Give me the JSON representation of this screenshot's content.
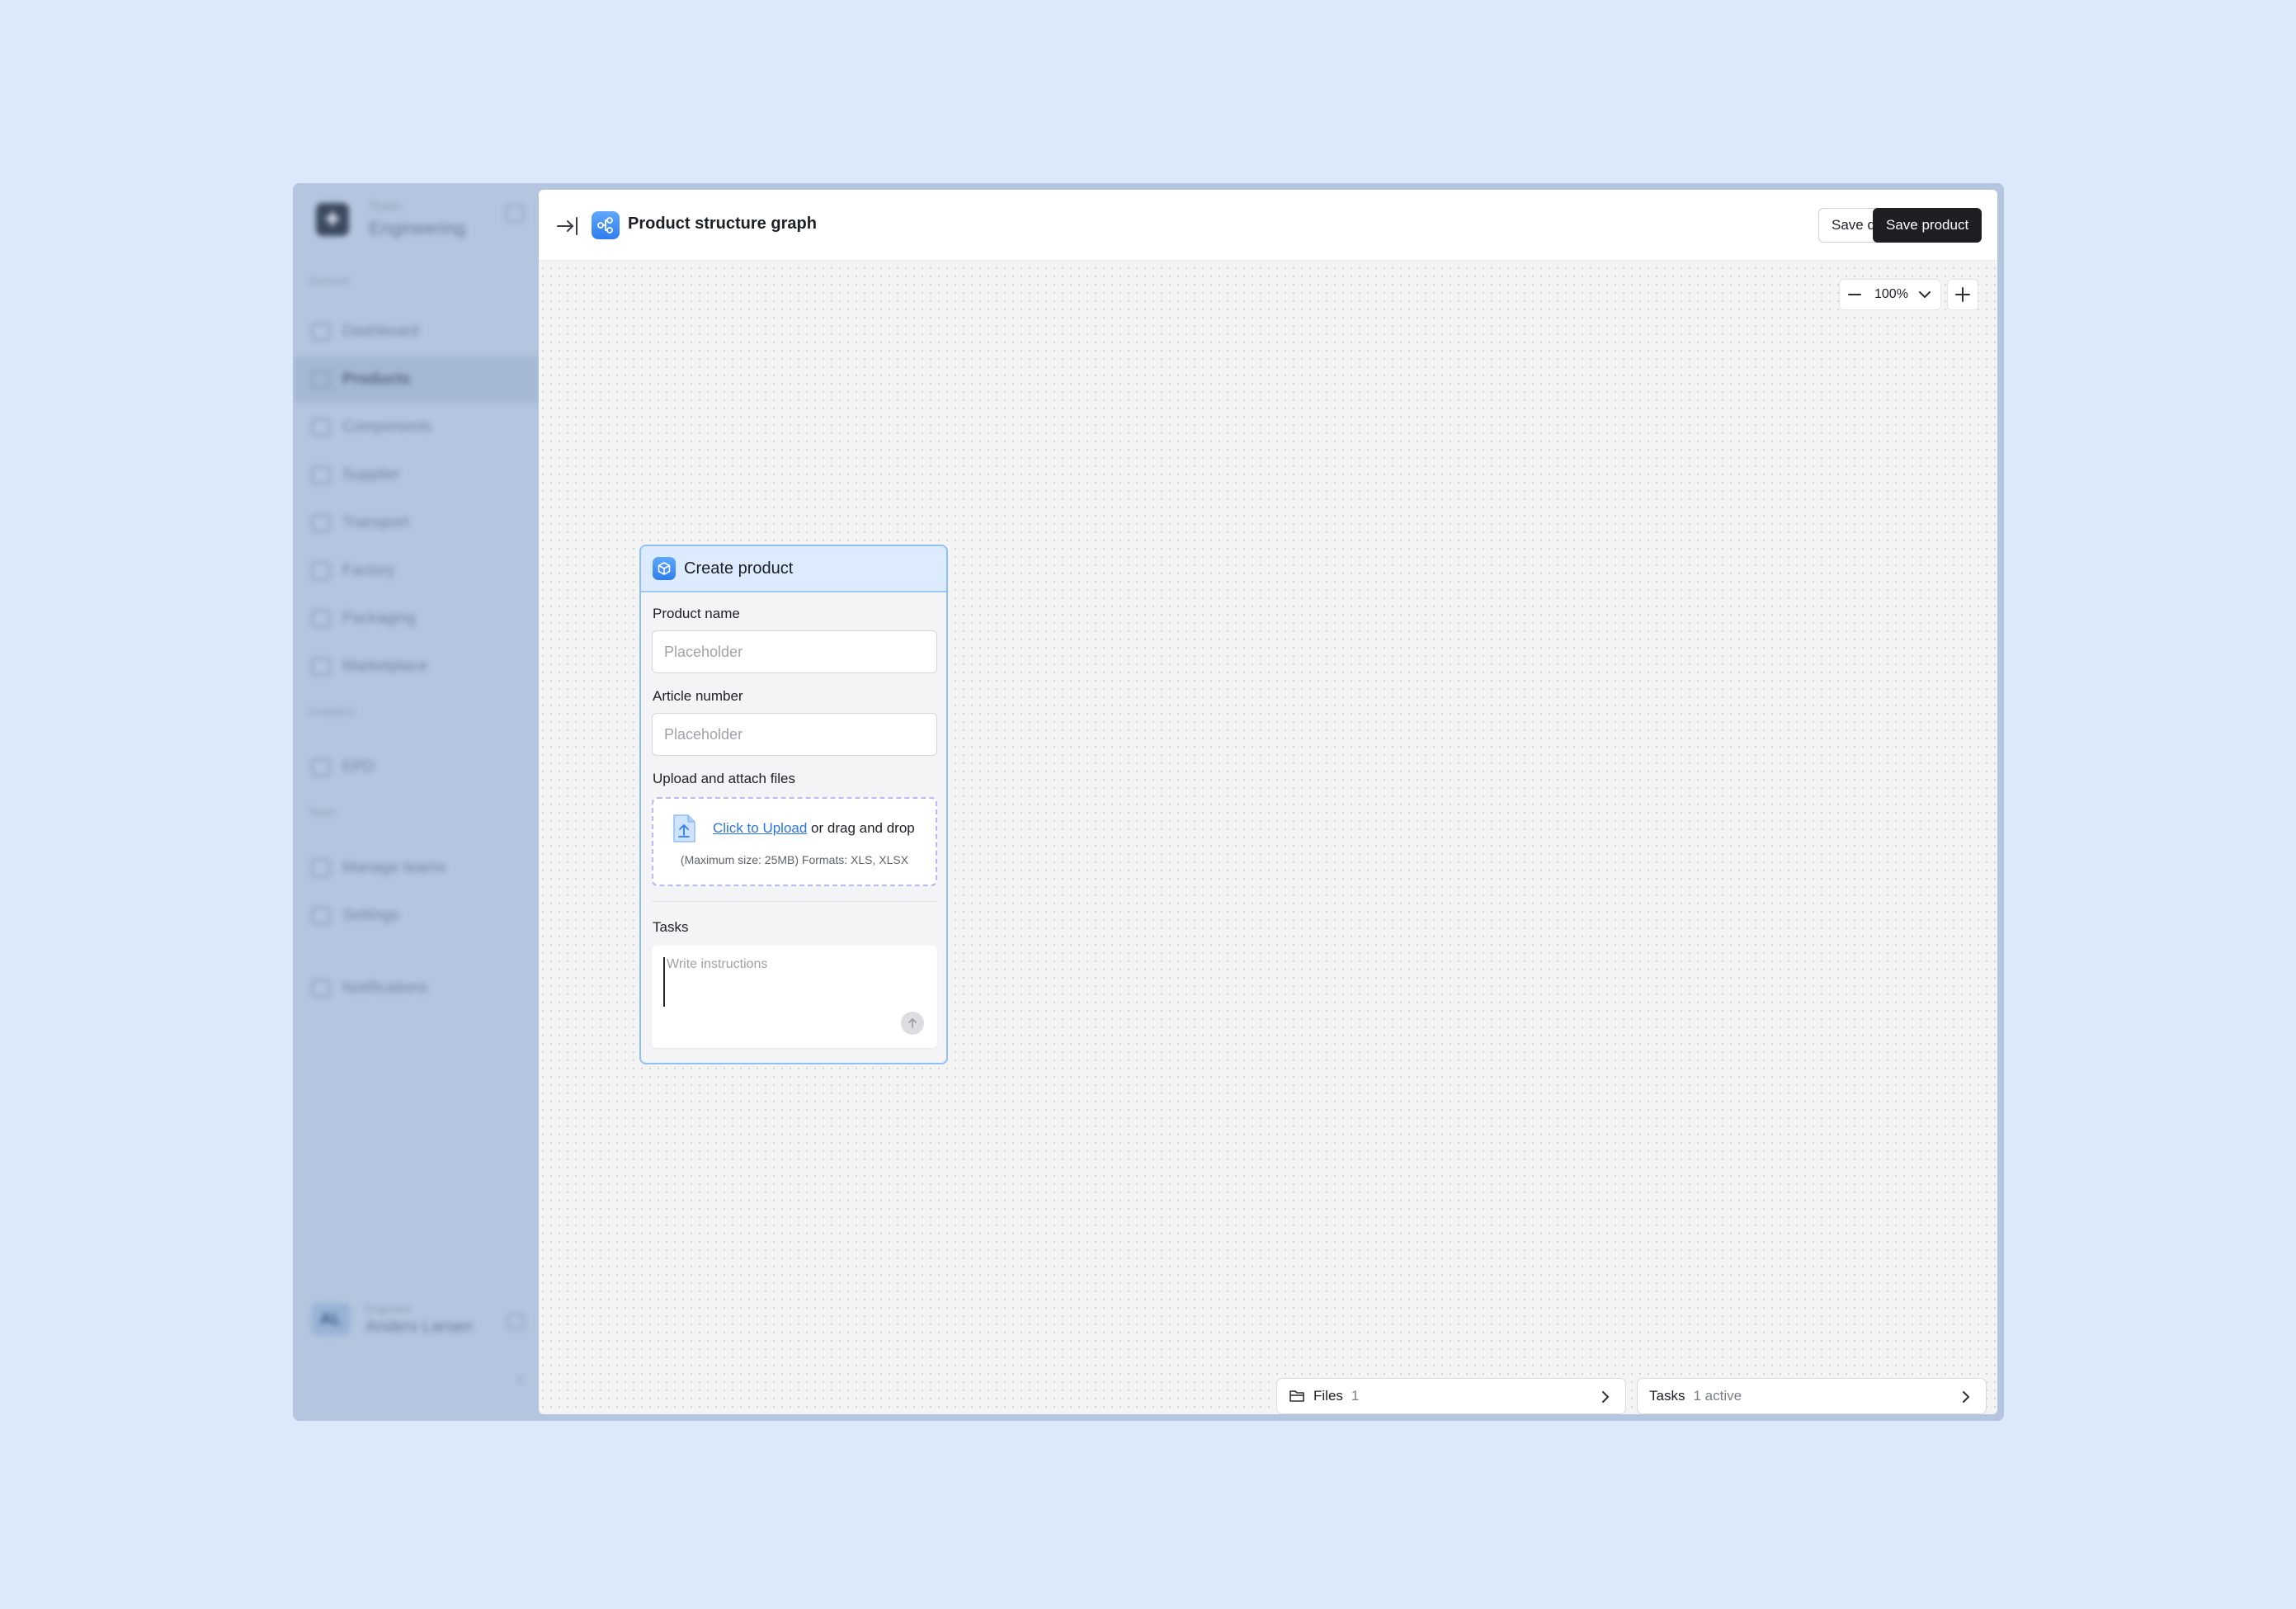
{
  "sidebar": {
    "workspace_small": "Team",
    "workspace_name": "Engineering",
    "section_general": "General",
    "section_analytics": "Analytics",
    "section_team": "Team",
    "items": [
      {
        "label": "Dashboard"
      },
      {
        "label": "Products"
      },
      {
        "label": "Components"
      },
      {
        "label": "Supplier"
      },
      {
        "label": "Transport"
      },
      {
        "label": "Factory"
      },
      {
        "label": "Packaging"
      },
      {
        "label": "Marketplace"
      },
      {
        "label": "EPD"
      },
      {
        "label": "Manage teams"
      },
      {
        "label": "Settings"
      },
      {
        "label": "Notifications"
      }
    ],
    "user_initials": "AL",
    "user_small": "Engineer",
    "user_name": "Anders Larsen"
  },
  "header": {
    "title": "Product structure graph",
    "save_draft_label": "Save draft",
    "save_product_label": "Save product"
  },
  "zoom": {
    "value": "100%"
  },
  "node": {
    "title": "Create product",
    "product_name_label": "Product name",
    "product_name_placeholder": "Placeholder",
    "article_number_label": "Article number",
    "article_number_placeholder": "Placeholder",
    "upload_label": "Upload and attach files",
    "upload_link": "Click to Upload",
    "upload_text": " or drag and drop",
    "upload_hint": "(Maximum size: 25MB) Formats: XLS, XLSX",
    "tasks_label": "Tasks",
    "tasks_placeholder": "Write instructions"
  },
  "bottom": {
    "files_label": "Files",
    "files_count": "1",
    "tasks_label": "Tasks",
    "tasks_count": "1 active"
  },
  "colors": {
    "background": "#dce9fb",
    "accent": "#2f7df0",
    "primary_button": "#1d1f22",
    "node_border": "#8fc0f5"
  }
}
